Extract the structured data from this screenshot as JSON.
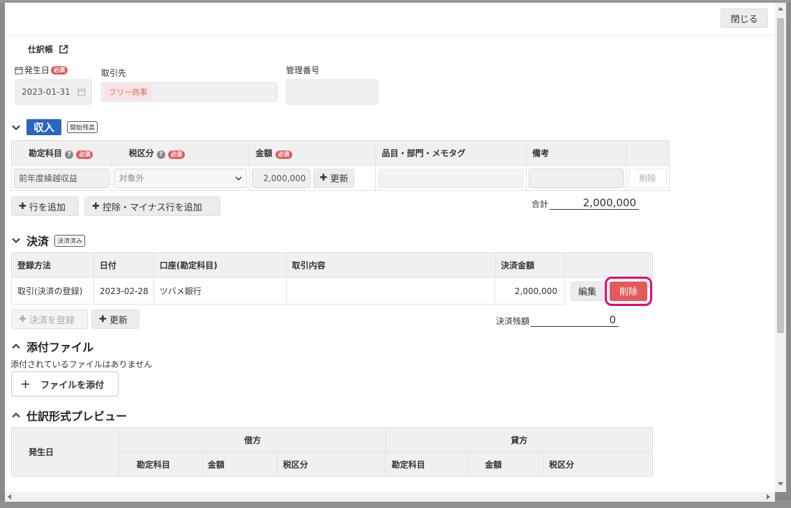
{
  "header": {
    "close_label": "閉じる",
    "journal_link": "仕訳帳"
  },
  "form": {
    "date_label": "発生日",
    "required": "必須",
    "date_value": "2023-01-31",
    "partner_label": "取引先",
    "partner_tag": "フリー商事",
    "mgmt_label": "管理番号"
  },
  "income": {
    "title": "収入",
    "badge": "開始残高",
    "columns": [
      "勘定科目",
      "税区分",
      "金額",
      "品目・部門・メモタグ",
      "備考"
    ],
    "row": {
      "account": "前年度繰越収益",
      "tax": "対象外",
      "amount": "2,000,000",
      "update_label": "更新",
      "delete_label": "削除"
    },
    "add_row_label": "行を追加",
    "add_minus_label": "控除・マイナス行を追加",
    "total_label": "合計",
    "total_value": "2,000,000"
  },
  "payment": {
    "title": "決済",
    "badge": "決済済み",
    "columns": [
      "登録方法",
      "日付",
      "口座(勘定科目)",
      "取引内容",
      "決済金額"
    ],
    "row": {
      "method": "取引(決済の登録)",
      "date": "2023-02-28",
      "account": "ツバメ銀行",
      "content": "",
      "amount": "2,000,000",
      "edit_label": "編集",
      "delete_label": "削除"
    },
    "register_label": "決済を登録",
    "update_label": "更新",
    "remaining_label": "決済残額",
    "remaining_value": "0"
  },
  "attachments": {
    "title": "添付ファイル",
    "empty_msg": "添付されているファイルはありません",
    "add_label": "ファイルを添付"
  },
  "preview": {
    "title": "仕訳形式プレビュー",
    "date_col": "発生日",
    "debit": "借方",
    "credit": "貸方",
    "sub_cols": [
      "勘定科目",
      "金額",
      "税区分"
    ]
  },
  "colors": {
    "accent": "#2a64c5",
    "danger": "#e45a5a",
    "highlight": "#e5006e"
  }
}
